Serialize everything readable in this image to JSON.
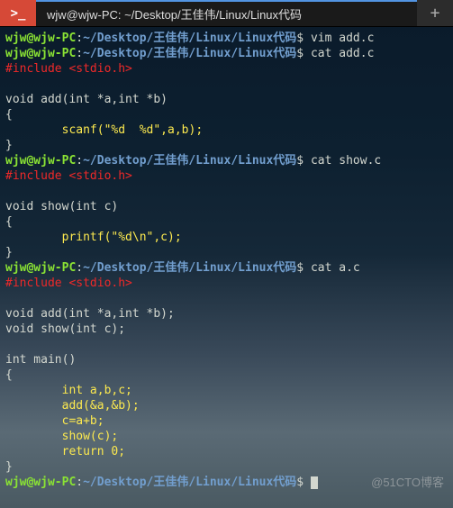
{
  "titlebar": {
    "app_icon_glyph": ">_",
    "tab_title": "wjw@wjw-PC: ~/Desktop/王佳伟/Linux/Linux代码",
    "new_tab": "+"
  },
  "prompt": {
    "user_host": "wjw@wjw-PC",
    "sep": ":",
    "path": "~/Desktop/王佳伟/Linux/Linux代码",
    "symbol": "$"
  },
  "commands": {
    "c1": "vim add.c",
    "c2": "cat add.c",
    "c3": "cat show.c",
    "c4": "cat a.c",
    "c5": ""
  },
  "code": {
    "include": "#include <stdio.h>",
    "add_sig": "void add(int *a,int *b)",
    "brace_open": "{",
    "scanf_line": "        scanf(\"%d  %d\",a,b);",
    "brace_close": "}",
    "show_sig": "void show(int c)",
    "printf_line": "        printf(\"%d\\n\",c);",
    "add_decl": "void add(int *a,int *b);",
    "show_decl": "void show(int c);",
    "main_sig": "int main()",
    "m1": "        int a,b,c;",
    "m2": "        add(&a,&b);",
    "m3": "        c=a+b;",
    "m4": "        show(c);",
    "m5": "        return 0;",
    "blank": ""
  },
  "watermark": "@51CTO博客"
}
